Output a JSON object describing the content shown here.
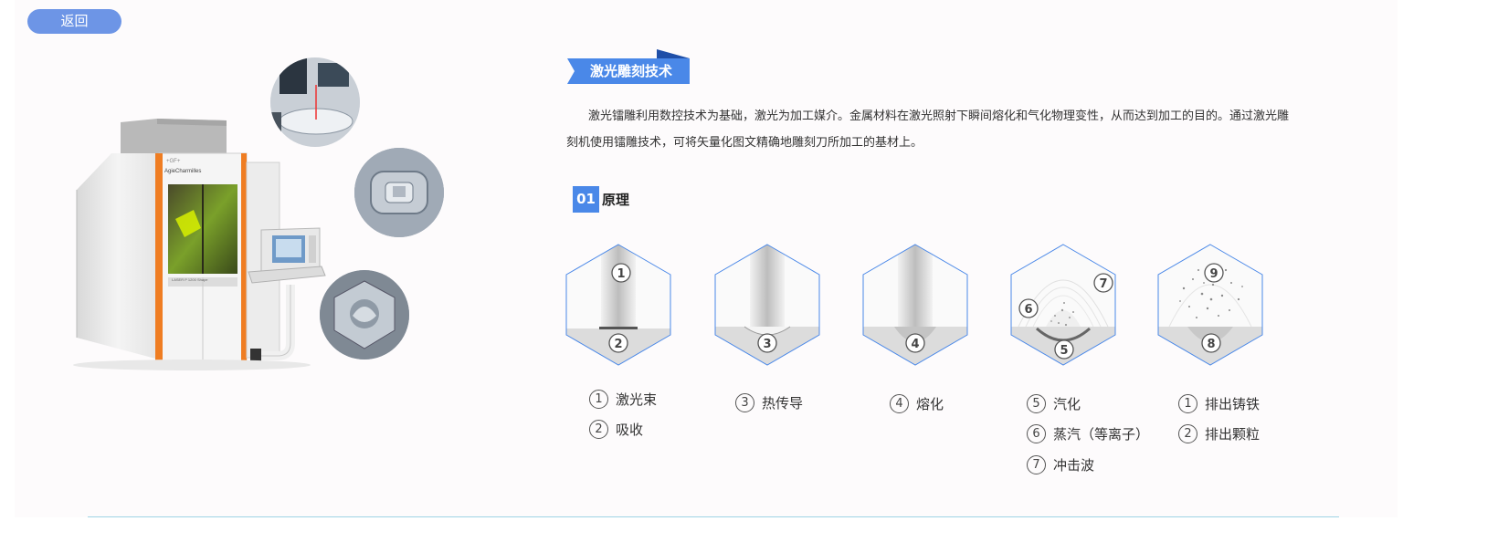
{
  "nav": {
    "back_label": "返回"
  },
  "machine": {
    "brand_logo": "+GF+",
    "brand_name": "AgieCharmilles",
    "model": "LASER P 1200 Shape"
  },
  "section_title": "激光雕刻技术",
  "intro_text": "激光镭雕利用数控技术为基础，激光为加工媒介。金属材料在激光照射下瞬间熔化和气化物理变性，从而达到加工的目的。通过激光雕刻机使用镭雕技术，可将矢量化图文精确地雕刻刀所加工的基材上。",
  "principle": {
    "number": "01",
    "title": "原理"
  },
  "steps": [
    {
      "markers": [
        "1",
        "2"
      ],
      "legend": [
        {
          "num": "1",
          "label": "激光束"
        },
        {
          "num": "2",
          "label": "吸收"
        }
      ]
    },
    {
      "markers": [
        "3"
      ],
      "legend": [
        {
          "num": "3",
          "label": "热传导"
        }
      ]
    },
    {
      "markers": [
        "4"
      ],
      "legend": [
        {
          "num": "4",
          "label": "熔化"
        }
      ]
    },
    {
      "markers": [
        "5",
        "6",
        "7"
      ],
      "legend": [
        {
          "num": "5",
          "label": "汽化"
        },
        {
          "num": "6",
          "label": "蒸汽（等离子）"
        },
        {
          "num": "7",
          "label": "冲击波"
        }
      ]
    },
    {
      "markers": [
        "8",
        "9"
      ],
      "legend": [
        {
          "num": "1",
          "label": "排出铸铁"
        },
        {
          "num": "2",
          "label": "排出颗粒"
        }
      ]
    }
  ],
  "colors": {
    "accent": "#4a88e8",
    "back_button": "#6d95e6",
    "hex_border": "#4a88e8",
    "rule": "#9fd3e5"
  }
}
